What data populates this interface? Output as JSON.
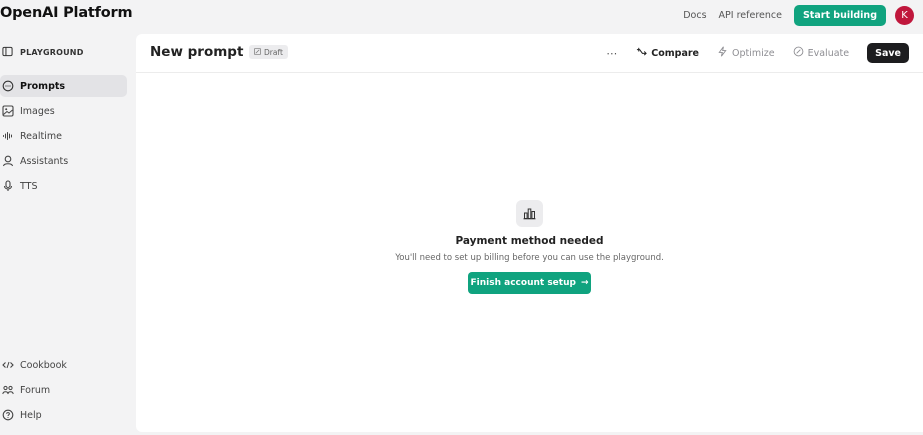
{
  "brand": "OpenAI  Platform",
  "topbar": {
    "docs": "Docs",
    "api_reference": "API reference",
    "start_building": "Start building",
    "avatar_initial": "K"
  },
  "sidebar": {
    "section": "PLAYGROUND",
    "items": [
      {
        "label": "Prompts",
        "icon": "chat-bubble-icon",
        "active": true
      },
      {
        "label": "Images",
        "icon": "image-icon",
        "active": false
      },
      {
        "label": "Realtime",
        "icon": "waveform-icon",
        "active": false
      },
      {
        "label": "Assistants",
        "icon": "assistant-icon",
        "active": false
      },
      {
        "label": "TTS",
        "icon": "microphone-icon",
        "active": false
      }
    ],
    "footer": [
      {
        "label": "Cookbook",
        "icon": "code-icon"
      },
      {
        "label": "Forum",
        "icon": "people-icon"
      },
      {
        "label": "Help",
        "icon": "help-icon"
      }
    ]
  },
  "header": {
    "title": "New prompt",
    "badge": "Draft",
    "compare": "Compare",
    "optimize": "Optimize",
    "evaluate": "Evaluate",
    "save": "Save"
  },
  "empty_state": {
    "title": "Payment method needed",
    "description": "You'll need to set up billing before you can use the playground.",
    "button": "Finish account setup",
    "button_arrow": "→"
  },
  "colors": {
    "accent": "#10a37f",
    "avatar": "#c0173c",
    "save_button": "#1d1d1f",
    "background": "#f3f3f4"
  }
}
